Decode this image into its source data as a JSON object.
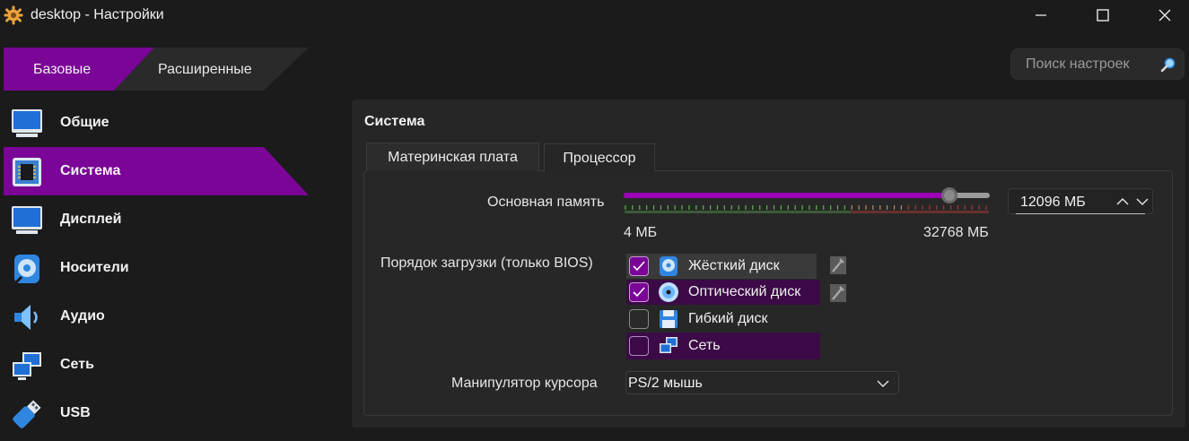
{
  "window": {
    "title": "desktop - Настройки",
    "icon": "gear-icon"
  },
  "mode_tabs": {
    "basic": "Базовые",
    "advanced": "Расширенные",
    "selected": "basic"
  },
  "search": {
    "placeholder": "Поиск настроек"
  },
  "sidebar": {
    "items": [
      {
        "label": "Общие",
        "icon": "general-monitor-icon"
      },
      {
        "label": "Система",
        "icon": "chip-icon",
        "selected": true
      },
      {
        "label": "Дисплей",
        "icon": "display-monitor-icon"
      },
      {
        "label": "Носители",
        "icon": "storage-disc-icon"
      },
      {
        "label": "Аудио",
        "icon": "speaker-icon"
      },
      {
        "label": "Сеть",
        "icon": "network-icon"
      },
      {
        "label": "USB",
        "icon": "usb-icon"
      }
    ]
  },
  "panel": {
    "title": "Система",
    "tabs": [
      "Материнская плата",
      "Процессор"
    ],
    "active_tab": 0
  },
  "memory": {
    "label": "Основная память",
    "value_mb": 12096,
    "min_mb": 4,
    "max_mb": 32768,
    "min_label": "4 МБ",
    "max_label": "32768 МБ",
    "spin_text": "12096 МБ"
  },
  "boot_order": {
    "label": "Порядок загрузки (только BIOS)",
    "items": [
      {
        "label": "Жёсткий диск",
        "checked": true,
        "icon": "hard-disk-icon"
      },
      {
        "label": "Оптический диск",
        "checked": true,
        "icon": "optical-disc-icon"
      },
      {
        "label": "Гибкий диск",
        "checked": false,
        "icon": "floppy-icon"
      },
      {
        "label": "Сеть",
        "checked": false,
        "icon": "network-icon"
      }
    ]
  },
  "pointer": {
    "label": "Манипулятор курсора",
    "value": "PS/2 мышь"
  },
  "colors": {
    "accent": "#7a0596",
    "accent_dark": "#3c0a47",
    "background": "#1b1b1b",
    "panel": "#262626"
  }
}
